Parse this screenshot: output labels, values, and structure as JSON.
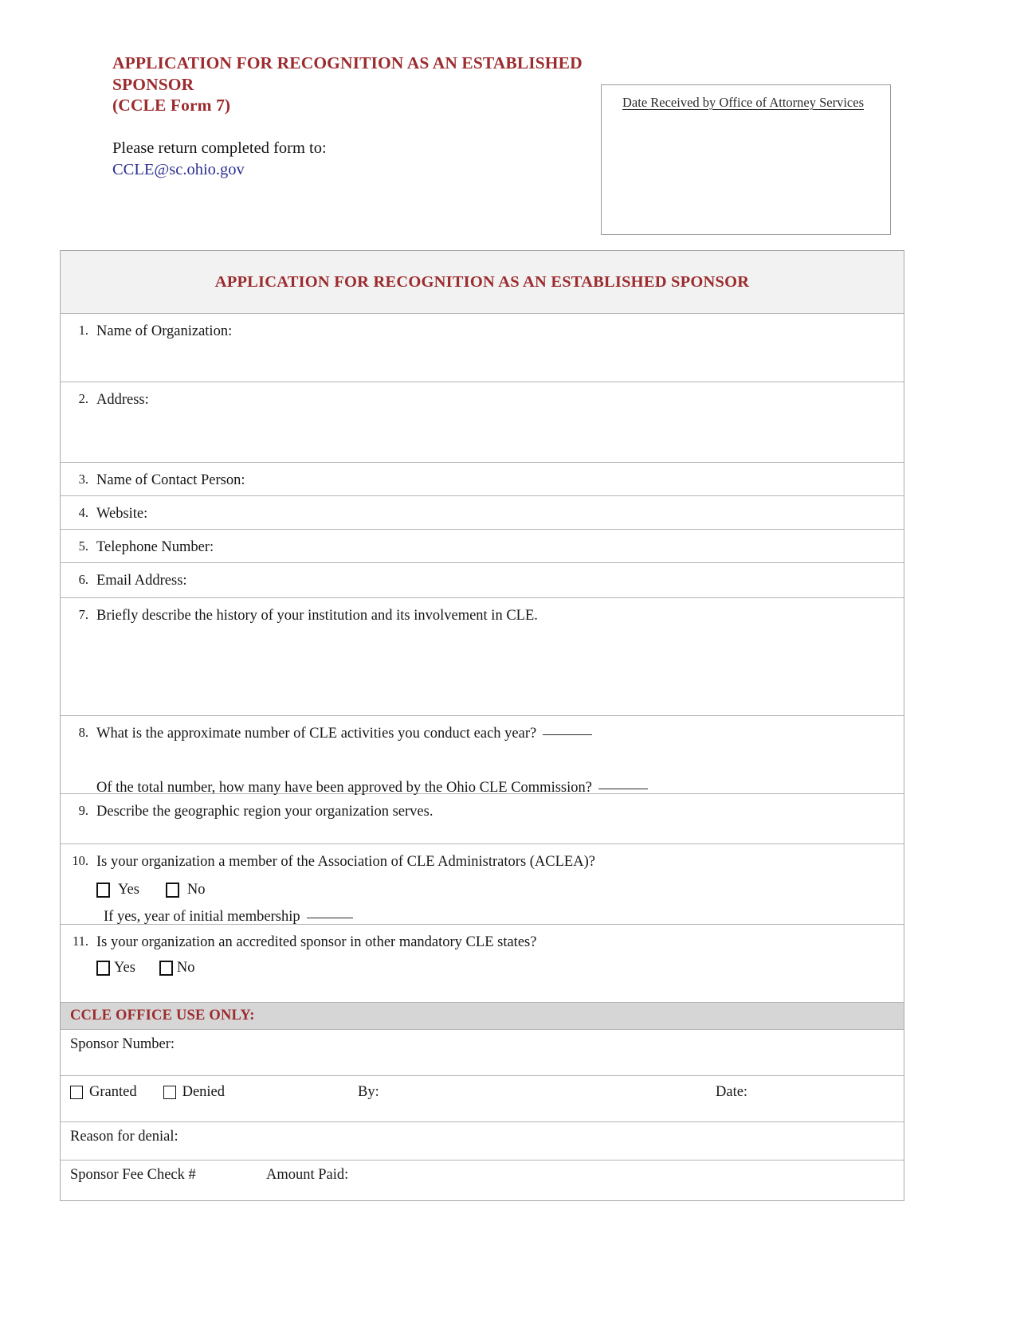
{
  "header": {
    "title_line1": "APPLICATION FOR RECOGNITION AS AN ESTABLISHED SPONSOR",
    "title_line2": "(CCLE Form 7)",
    "return_instruction": "Please return completed form to:",
    "return_email": "CCLE@sc.ohio.gov",
    "date_box_label": "Date Received by Office of Attorney Services"
  },
  "table": {
    "banner_title": "APPLICATION FOR RECOGNITION AS AN ESTABLISHED SPONSOR",
    "items": [
      {
        "num": "1.",
        "text": "Name of Organization:"
      },
      {
        "num": "2.",
        "text": "Address:"
      },
      {
        "num": "3.",
        "text": "Name of  Contact Person:"
      },
      {
        "num": "4.",
        "text": "Website:"
      },
      {
        "num": "5.",
        "text": "Telephone  Number:"
      },
      {
        "num": "6.",
        "text": "Email Address:"
      },
      {
        "num": "7.",
        "text": "Briefly describe the history of your institution and its involvement in CLE."
      },
      {
        "num": "8.",
        "text": "What is the approximate number of CLE activities you conduct each year?",
        "subtext": "Of the total number, how many have been approved by the Ohio CLE Commission?"
      },
      {
        "num": "9.",
        "text": "Describe the geographic region your organization serves."
      },
      {
        "num": "10.",
        "text": "Is your organization a member of the Association of CLE Administrators (ACLEA)?",
        "yes_label": "Yes",
        "no_label": "No",
        "note": "If yes, year of initial membership"
      },
      {
        "num": "11.",
        "text": "Is your organization an accredited sponsor in other mandatory CLE states?",
        "yes_label": "Yes",
        "no_label": "No"
      }
    ]
  },
  "office_use": {
    "banner": "CCLE OFFICE USE ONLY:",
    "sponsor_number_label": "Sponsor Number:",
    "granted_label": "Granted",
    "denied_label": "Denied",
    "by_label": "By:",
    "date_label": "Date:",
    "reason_label": "Reason for denial:",
    "fee_check_label": "Sponsor Fee Check #",
    "amount_paid_label": "Amount Paid:"
  },
  "colors": {
    "accent_red": "#9c2b2e",
    "link_blue": "#2b2f8f",
    "banner_gray": "#f2f2f2",
    "office_gray": "#d6d6d6",
    "border_gray": "#b4b4b4"
  }
}
